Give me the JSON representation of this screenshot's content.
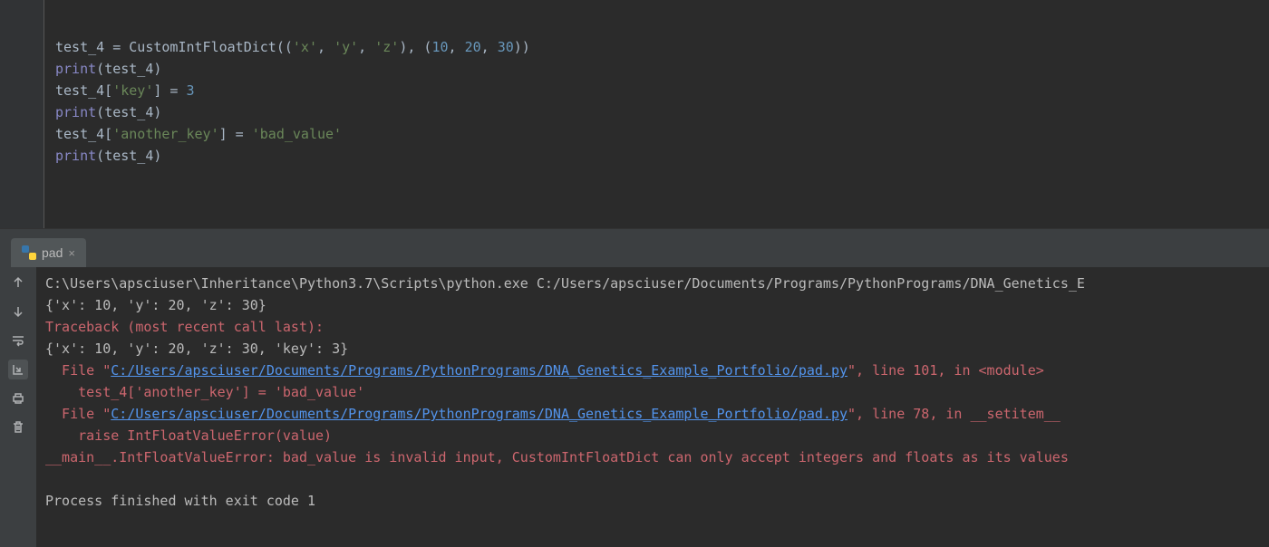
{
  "editor": {
    "code": {
      "l1": {
        "var": "test_4 = ",
        "cls": "CustomIntFloatDict",
        "open": "((",
        "s1": "'x'",
        "c": ", ",
        "s2": "'y'",
        "s3": "'z'",
        "mid": "), (",
        "n1": "10",
        "n2": "20",
        "n3": "30",
        "close": "))"
      },
      "l2": {
        "fn": "print",
        "open": "(",
        "arg": "test_4",
        "close": ")"
      },
      "l3": {
        "var": "test_4[",
        "key": "'key'",
        "rest": "] = ",
        "num": "3"
      },
      "l4": {
        "fn": "print",
        "open": "(",
        "arg": "test_4",
        "close": ")"
      },
      "l5": {
        "var": "test_4[",
        "key": "'another_key'",
        "rest": "] = ",
        "val": "'bad_value'"
      },
      "l6": {
        "fn": "print",
        "open": "(",
        "arg": "test_4",
        "close": ")"
      }
    }
  },
  "tab": {
    "label": "pad",
    "close": "×"
  },
  "console": {
    "l1": "C:\\Users\\apsciuser\\Inheritance\\Python3.7\\Scripts\\python.exe C:/Users/apsciuser/Documents/Programs/PythonPrograms/DNA_Genetics_E",
    "l2": "{'x': 10, 'y': 20, 'z': 30}",
    "l3": "Traceback (most recent call last):",
    "l4": "{'x': 10, 'y': 20, 'z': 30, 'key': 3}",
    "l5a": "  File \"",
    "l5link": "C:/Users/apsciuser/Documents/Programs/PythonPrograms/DNA_Genetics_Example_Portfolio/pad.py",
    "l5b": "\", line 101, in <module>",
    "l6": "    test_4['another_key'] = 'bad_value'",
    "l7a": "  File \"",
    "l7link": "C:/Users/apsciuser/Documents/Programs/PythonPrograms/DNA_Genetics_Example_Portfolio/pad.py",
    "l7b": "\", line 78, in __setitem__",
    "l8": "    raise IntFloatValueError(value)",
    "l9": "__main__.IntFloatValueError: bad_value is invalid input, CustomIntFloatDict can only accept integers and floats as its values",
    "l10": "",
    "l11": "Process finished with exit code 1"
  }
}
